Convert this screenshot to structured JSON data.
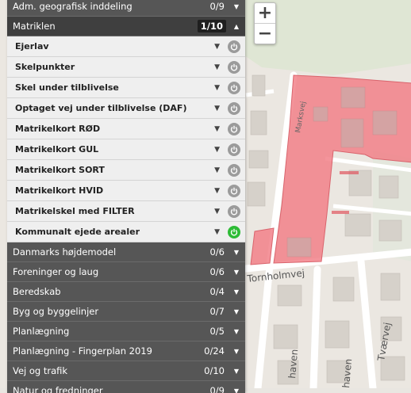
{
  "zoom": {
    "in_label": "+",
    "out_label": "−"
  },
  "map_labels": {
    "street1": "Marksvej",
    "street2": "Tornholmvej",
    "street3": "Tværvej",
    "street4": "haven",
    "street5": "haven"
  },
  "groups_top": [
    {
      "label": "Adm. geografisk inddeling",
      "count": "0/9"
    },
    {
      "label": "Matriklen",
      "count": "1/10",
      "open": true
    }
  ],
  "layers": [
    {
      "label": "Ejerlav",
      "on": false
    },
    {
      "label": "Skelpunkter",
      "on": false
    },
    {
      "label": "Skel under tilblivelse",
      "on": false
    },
    {
      "label": "Optaget vej under tilblivelse (DAF)",
      "on": false
    },
    {
      "label": "Matrikelkort RØD",
      "on": false
    },
    {
      "label": "Matrikelkort GUL",
      "on": false
    },
    {
      "label": "Matrikelkort SORT",
      "on": false
    },
    {
      "label": "Matrikelkort HVID",
      "on": false
    },
    {
      "label": "Matrikelskel med FILTER",
      "on": false
    },
    {
      "label": "Kommunalt ejede arealer",
      "on": true
    }
  ],
  "groups_bottom": [
    {
      "label": "Danmarks højdemodel",
      "count": "0/6"
    },
    {
      "label": "Foreninger og laug",
      "count": "0/6"
    },
    {
      "label": "Beredskab",
      "count": "0/4"
    },
    {
      "label": "Byg og byggelinjer",
      "count": "0/7"
    },
    {
      "label": "Planlægning",
      "count": "0/5"
    },
    {
      "label": "Planlægning - Fingerplan 2019",
      "count": "0/24"
    },
    {
      "label": "Vej og trafik",
      "count": "0/10"
    },
    {
      "label": "Natur og fredninger",
      "count": "0/9"
    }
  ],
  "colors": {
    "owned_area": "#f08080",
    "power_on": "#2dbb36",
    "power_off": "#9b9b9b"
  }
}
